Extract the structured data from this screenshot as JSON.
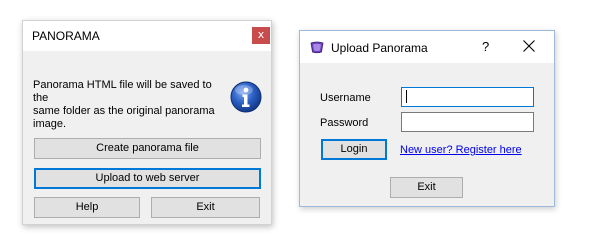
{
  "panorama_dialog": {
    "title": "PANORAMA",
    "close_label": "x",
    "message": "Panorama HTML file will be saved to the\nsame folder as the original panorama\nimage.",
    "info_icon": "info-icon",
    "buttons": {
      "create": "Create panorama file",
      "upload": "Upload to web server",
      "help": "Help",
      "exit": "Exit"
    }
  },
  "upload_dialog": {
    "title": "Upload Panorama",
    "help_label": "?",
    "app_icon": "panorama-app-icon",
    "username_label": "Username",
    "password_label": "Password",
    "username_value": "",
    "password_value": "",
    "login_label": "Login",
    "register_link": "New user? Register here",
    "exit_label": "Exit"
  },
  "colors": {
    "window_bg": "#f0f0f0",
    "titlebar_bg": "#ffffff",
    "close_red": "#c94c4c",
    "focus_blue": "#0078d7",
    "link_blue": "#0000ee",
    "info_icon_blue": "#1d4fb0"
  }
}
